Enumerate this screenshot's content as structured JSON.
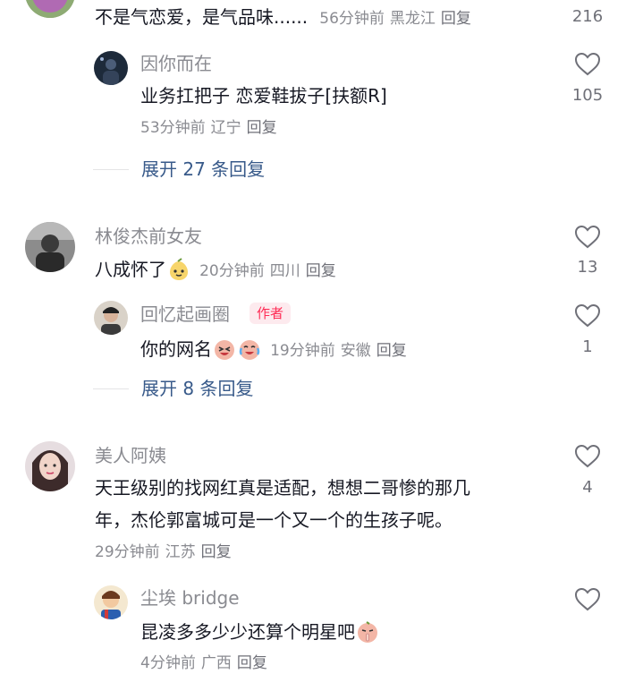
{
  "comments": {
    "c0": {
      "text": "不是气恋爱，是气品味......",
      "time": "56分钟前",
      "location": "黑龙江",
      "reply_label": "回复",
      "likes": "216",
      "replies": {
        "r0": {
          "username": "因你而在",
          "text": "业务扛把子  恋爱鞋拔子[扶额R]",
          "time": "53分钟前",
          "location": "辽宁",
          "reply_label": "回复",
          "likes": "105"
        }
      },
      "expand_label": "展开 27 条回复"
    },
    "c1": {
      "username": "林俊杰前女友",
      "text": "八成怀了",
      "emoji": "pear-emoji",
      "time": "20分钟前",
      "location": "四川",
      "reply_label": "回复",
      "likes": "13",
      "replies": {
        "r0": {
          "username": "回忆起画圈",
          "badge": "作者",
          "text": "你的网名",
          "emojis": [
            "laughing-emoji",
            "crying-laughing-emoji"
          ],
          "time": "19分钟前",
          "location": "安徽",
          "reply_label": "回复",
          "likes": "1"
        }
      },
      "expand_label": "展开 8 条回复"
    },
    "c2": {
      "username": "美人阿姨",
      "text_line1": "天王级别的找网红真是适配，想想二哥惨的那几",
      "text_line2": "年，杰伦郭富城可是一个又一个的生孩子呢。",
      "time": "29分钟前",
      "location": "江苏",
      "reply_label": "回复",
      "likes": "4",
      "replies": {
        "r0": {
          "username": "尘埃 bridge",
          "text": "昆凌多多少少还算个明星吧",
          "emoji": "shush-emoji",
          "time": "4分钟前",
          "location": "广西",
          "reply_label": "回复"
        }
      }
    }
  },
  "colors": {
    "username": "#8a8b91",
    "text": "#161823",
    "expand_link": "#385a8a",
    "author_badge_text": "#fe2c55",
    "author_badge_bg": "#fdeaee"
  }
}
